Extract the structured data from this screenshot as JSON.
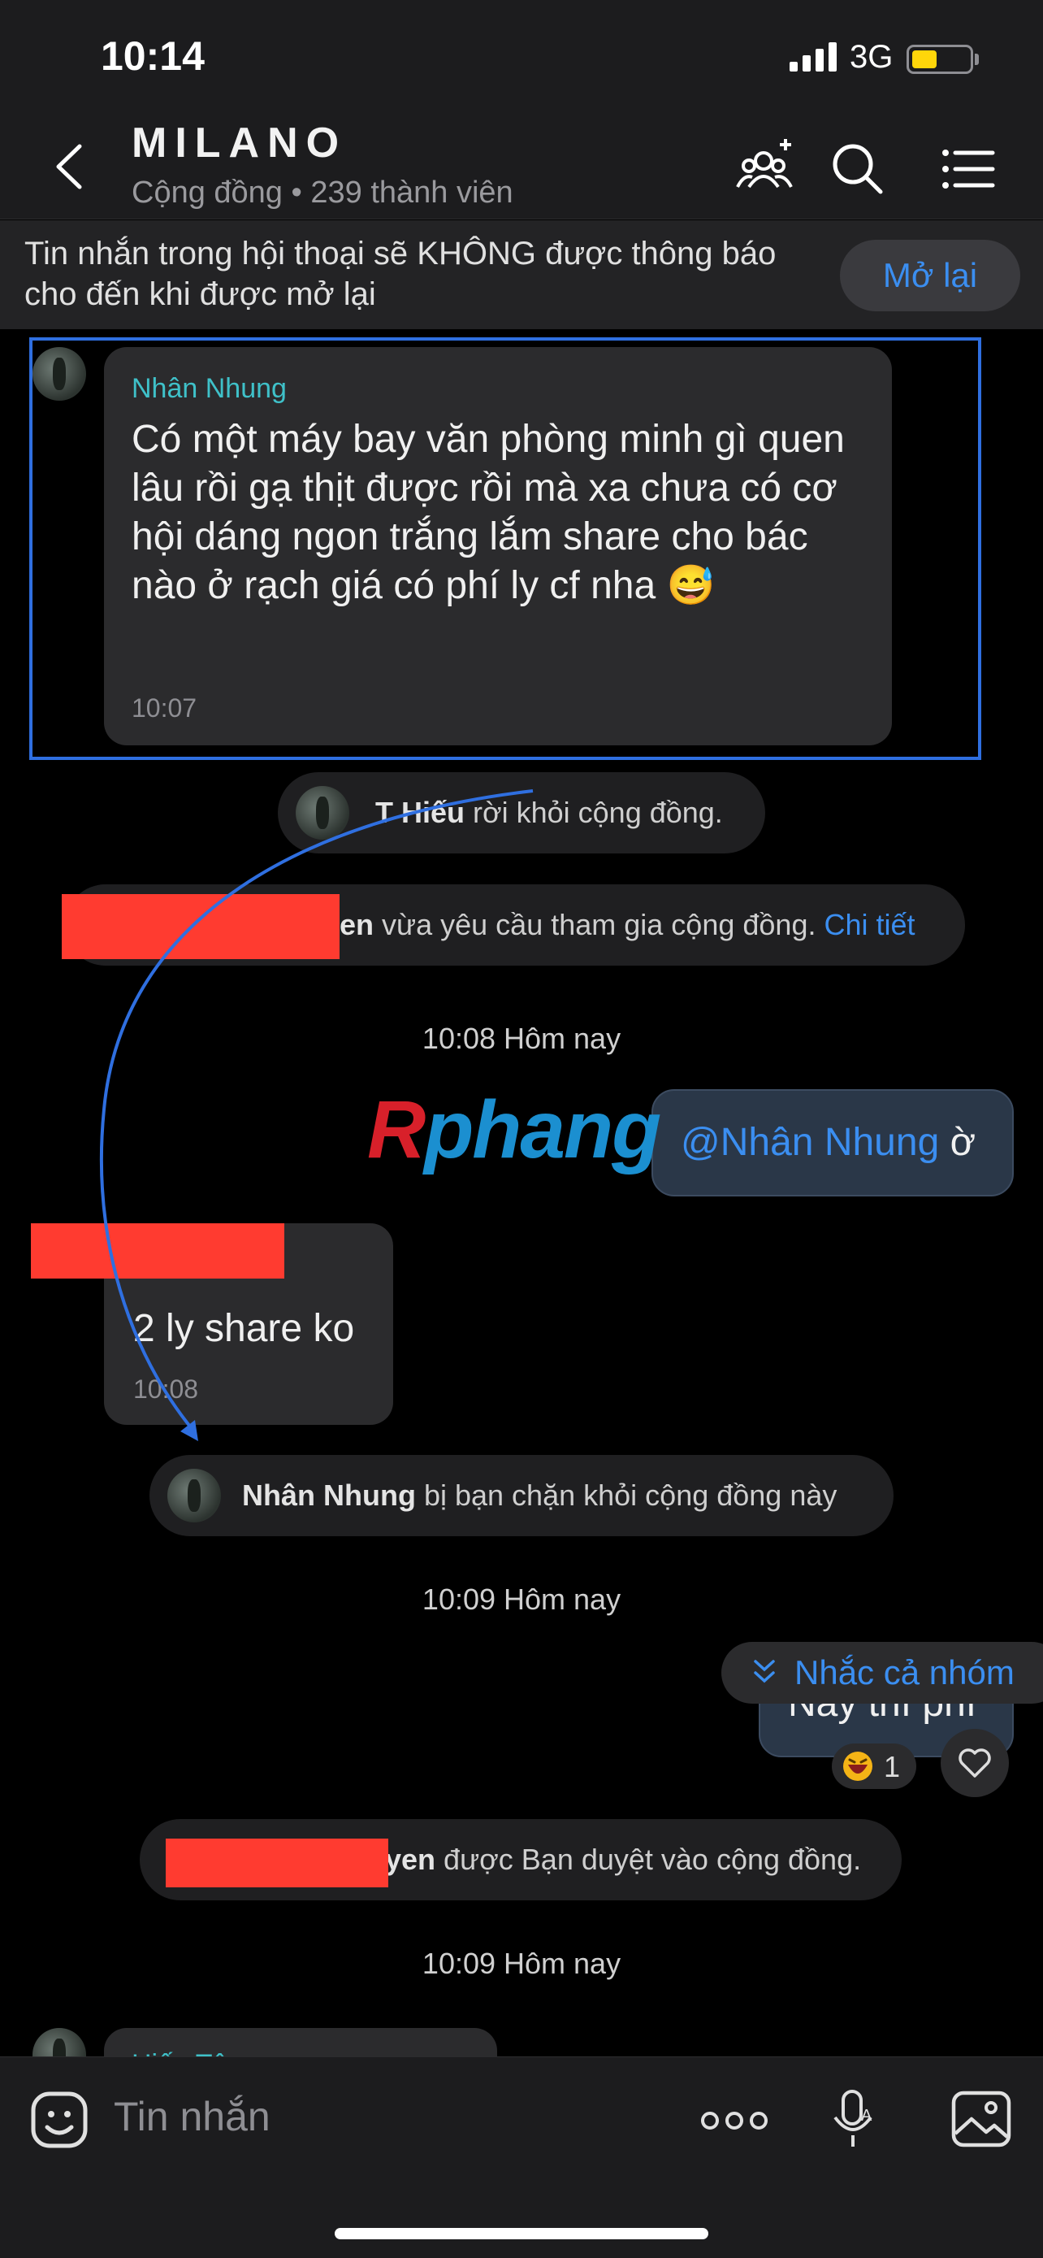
{
  "status_bar": {
    "time": "10:14",
    "network": "3G"
  },
  "header": {
    "title": "MILANO",
    "subtitle": "Cộng đồng • 239 thành viên",
    "icons": [
      "back-icon",
      "add-member-icon",
      "search-icon",
      "menu-icon"
    ]
  },
  "mute_banner": {
    "text": "Tin nhắn trong hội thoại sẽ KHÔNG được thông báo cho đến khi được mở lại",
    "button": "Mở lại"
  },
  "messages": {
    "m1": {
      "sender": "Nhân Nhung",
      "text": "Có một máy bay văn phòng minh gì quen lâu rồi gạ thịt được rồi mà xa chưa có cơ hội dáng ngon trắng lắm share cho bác nào ở rạch giá có phí ly cf nha 😅",
      "time": "10:07"
    },
    "sys1": {
      "name": "T Hiếu",
      "text": " rời khỏi cộng đồng."
    },
    "sys2": {
      "name_fragment": "en",
      "text": " vừa yêu cầu tham gia cộng đồng. ",
      "link": "Chi tiết"
    },
    "date1": "10:08 Hôm nay",
    "out1": {
      "mention": "@Nhân Nhung",
      "text": " ờ"
    },
    "in2": {
      "text": "2 ly share ko",
      "time": "10:08"
    },
    "sys3": {
      "name": "Nhân Nhung",
      "text": " bị bạn chặn khỏi cộng đồng này"
    },
    "date2": "10:09 Hôm nay",
    "out2": {
      "text": "Này thì phí",
      "reaction_count": "1"
    },
    "sys4": {
      "name_fragment": "yen",
      "text": " được Bạn duyệt vào cộng đồng."
    },
    "date3": "10:09 Hôm nay",
    "partial_sender": "Hiếu Tâm"
  },
  "watermark": {
    "part1": "R",
    "part2": "phang"
  },
  "remind_button": "Nhắc cả nhóm",
  "composer": {
    "placeholder": "Tin nhắn",
    "icons": [
      "sticker-icon",
      "more-icon",
      "voice-icon",
      "image-icon"
    ]
  },
  "colors": {
    "accent": "#3b8ef0",
    "sender": "#3fc1c9",
    "redaction": "#ff3b30",
    "highlight": "#2f6fe0"
  }
}
